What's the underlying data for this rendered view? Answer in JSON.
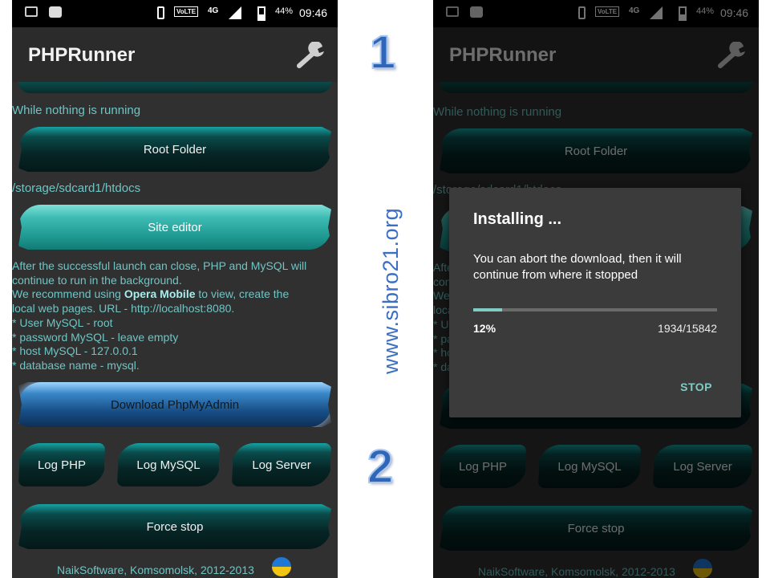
{
  "status_bar": {
    "battery": "44%",
    "time": "09:46",
    "volte": "VoLTE",
    "network": "4G"
  },
  "app": {
    "title": "PHPRunner"
  },
  "main": {
    "idle_text": "While nothing is running",
    "root_folder_button": "Root Folder",
    "root_path": "/storage/sdcard1/htdocs",
    "site_editor_button": "Site editor",
    "info": {
      "line1": "After the successful launch can close, PHP and MySQL will",
      "line2": "continue to run in the background.",
      "line3_prefix": " We recommend using ",
      "line3_bold": "Opera Mobile",
      "line3_suffix": " to view, create the",
      "line4": "local web pages. URL - http://localhost:8080.",
      "line5": " * User MySQL - root",
      "line6": " * password MySQL - leave empty",
      "line7": " * host MySQL - 127.0.0.1",
      "line8": " * database name - mysql."
    },
    "download_button": "Download PhpMyAdmin",
    "log_php_button": "Log PHP",
    "log_mysql_button": "Log MySQL",
    "log_server_button": "Log Server",
    "force_stop_button": "Force stop",
    "footer": "NaikSoftware, Komsomolsk, 2012-2013"
  },
  "dialog": {
    "title": "Installing ...",
    "message": "You can abort the download, then it will continue from where it stopped",
    "progress_percent_label": "12%",
    "progress_fraction": 0.12,
    "progress_count": "1934/15842",
    "stop_button": "STOP"
  },
  "annotations": {
    "step1": "1",
    "step2": "2",
    "watermark": "www.sibro21.org"
  },
  "colors": {
    "teal_text": "#6fc4c4",
    "accent": "#80cbc4",
    "annotation_blue": "#2f66b8"
  }
}
